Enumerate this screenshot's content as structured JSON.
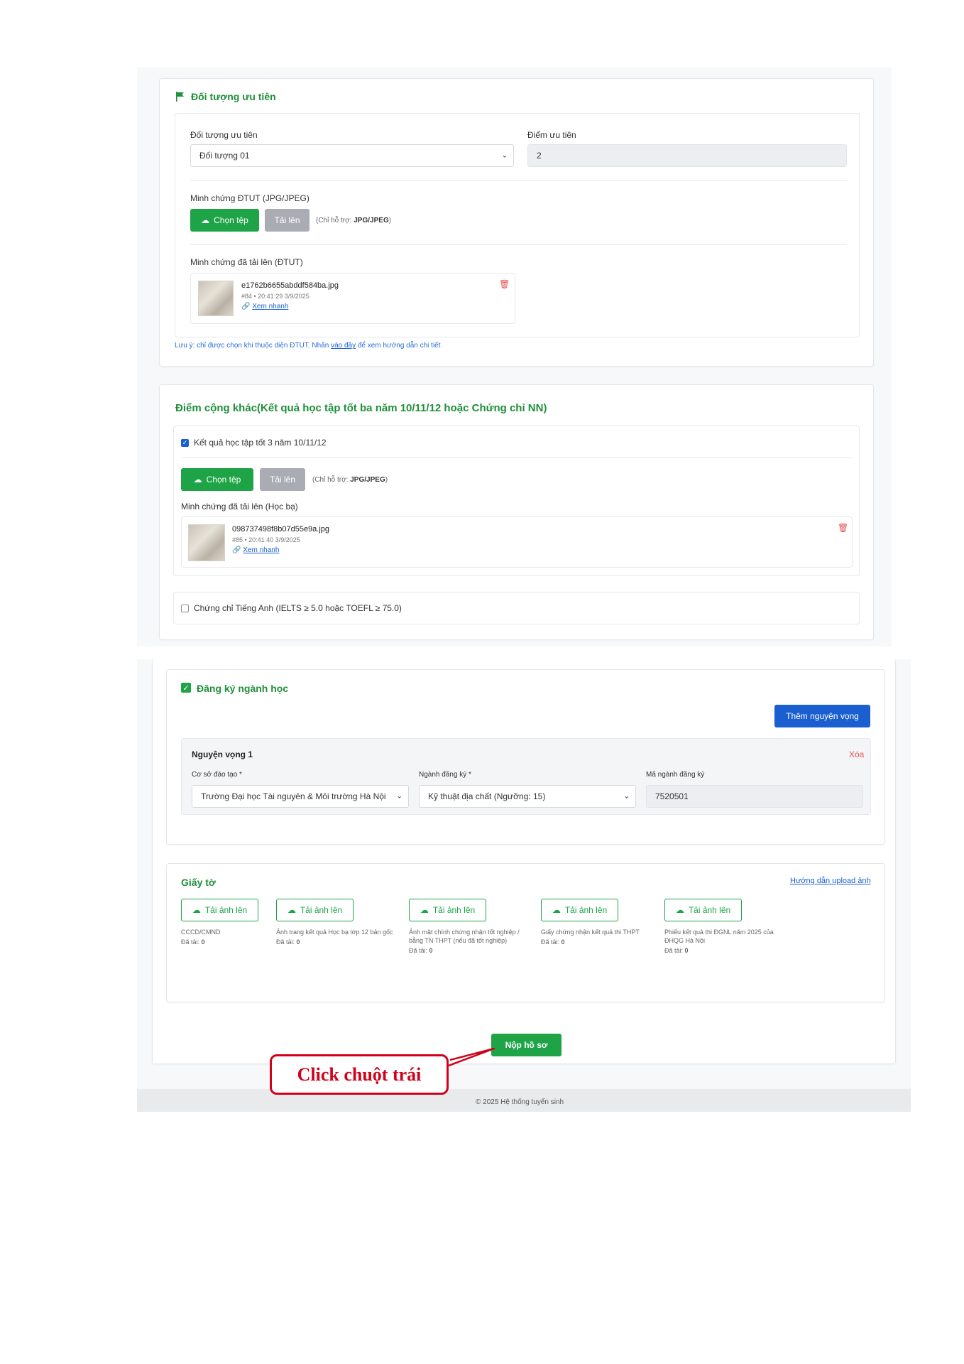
{
  "priority": {
    "section_title": "Đối tượng ưu tiên",
    "field_label": "Đối tượng ưu tiên",
    "field_value": "Đối tượng 01",
    "score_label": "Điểm ưu tiên",
    "score_value": "2",
    "evidence_label": "Minh chứng ĐTUT (JPG/JPEG)",
    "choose_button": "Chọn tệp",
    "upload_button": "Tải lên",
    "support_prefix": "(Chỉ hỗ trợ: ",
    "support_format": "JPG/JPEG",
    "support_suffix": ")",
    "uploaded_label": "Minh chứng đã tải lên (ĐTUT)",
    "file": {
      "name": "e1762b6655abddf584ba.jpg",
      "meta": "#84 • 20:41:29 3/9/2025",
      "preview": "Xem nhanh"
    },
    "note_prefix": "Lưu ý: chỉ được chọn khi thuộc diện ĐTUT. Nhấn ",
    "note_link": "vào đây",
    "note_suffix": " để xem hướng dẫn chi tiết"
  },
  "bonus": {
    "section_title": "Điểm cộng khác(Kết quả học tập tốt ba năm 10/11/12 hoặc Chứng chỉ NN)",
    "academic_checkbox": "Kết quả học tập tốt 3 năm 10/11/12",
    "choose_button": "Chọn tệp",
    "upload_button": "Tải lên",
    "support_prefix": "(Chỉ hỗ trợ: ",
    "support_format": "JPG/JPEG",
    "support_suffix": ")",
    "uploaded_label": "Minh chứng đã tải lên (Học bạ)",
    "file": {
      "name": "098737498f8b07d55e9a.jpg",
      "meta": "#85 • 20:41:40 3/9/2025",
      "preview": "Xem nhanh"
    },
    "english_checkbox": "Chứng chỉ Tiếng Anh (IELTS ≥ 5.0 hoặc TOEFL ≥ 75.0)"
  },
  "major": {
    "section_title": "Đăng ký ngành học",
    "add_button": "Thêm nguyện vọng",
    "wish_title": "Nguyện vọng 1",
    "delete_label": "Xóa",
    "school_label": "Cơ sở đào tạo *",
    "school_value": "Trường Đại học Tài nguyên & Môi trường Hà Nội",
    "major_label": "Ngành đăng ký *",
    "major_value": "Kỹ thuật địa chất (Ngưỡng: 15)",
    "code_label": "Mã ngành đăng ký",
    "code_value": "7520501"
  },
  "documents": {
    "section_title": "Giấy tờ",
    "guide_link": "Hướng dẫn upload ảnh",
    "upload_label": "Tải ảnh lên",
    "uploaded_prefix": "Đã tải: ",
    "items": [
      {
        "caption": "CCCD/CMND",
        "count": "0"
      },
      {
        "caption": "Ảnh trang kết quả Học bạ lớp 12 bản gốc",
        "count": "0"
      },
      {
        "caption": "Ảnh mặt chính chứng nhận tốt nghiệp / bằng TN THPT (nếu đã tốt nghiệp)",
        "count": "0"
      },
      {
        "caption": "Giấy chứng nhận kết quả thi THPT",
        "count": "0"
      },
      {
        "caption": "Phiếu kết quả thi ĐGNL năm 2025 của ĐHQG Hà Nội",
        "count": "0"
      }
    ]
  },
  "submit_button": "Nộp hồ sơ",
  "annotation": "Click chuột trái",
  "footer": "© 2025 Hệ thống tuyển sinh",
  "colors": {
    "green": "#1ea447",
    "title_green": "#1f8f3a",
    "blue": "#1a5fd0",
    "red_annotation": "#d0021b"
  }
}
